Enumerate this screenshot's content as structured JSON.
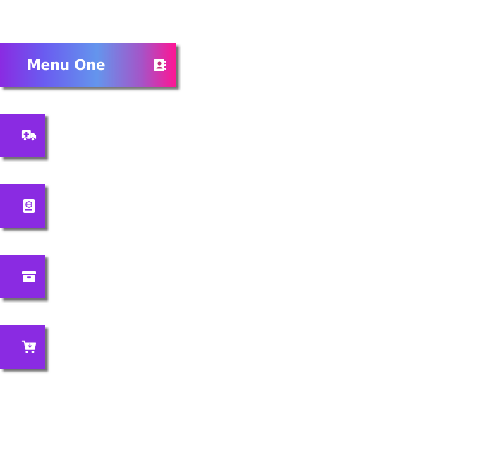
{
  "menu": {
    "items": [
      {
        "label": "Menu One",
        "icon": "address-book-icon",
        "expanded": true
      },
      {
        "label": "",
        "icon": "ambulance-icon",
        "expanded": false
      },
      {
        "label": "",
        "icon": "passport-icon",
        "expanded": false
      },
      {
        "label": "",
        "icon": "archive-box-icon",
        "expanded": false
      },
      {
        "label": "",
        "icon": "cart-download-icon",
        "expanded": false
      }
    ]
  },
  "colors": {
    "item_bg": "#8a2be2",
    "gradient_start": "#8a2be2",
    "gradient_mid": "#6495ed",
    "gradient_end": "#ff1493",
    "text": "#ffffff"
  }
}
